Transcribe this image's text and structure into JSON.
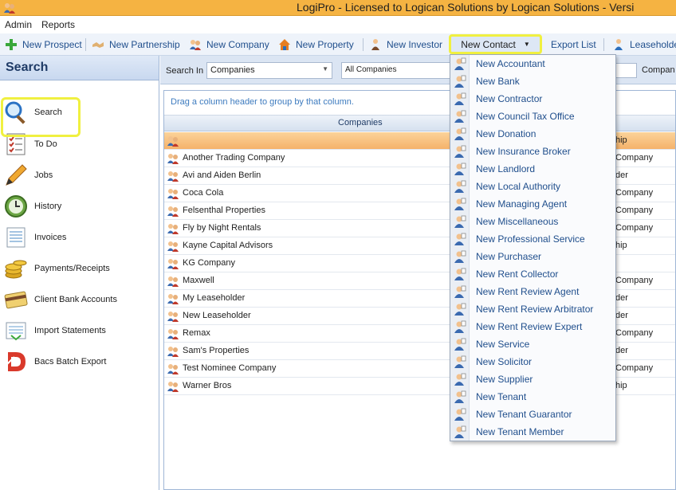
{
  "window": {
    "title": "LogiPro - Licensed to Logican Solutions by Logican Solutions - Versi"
  },
  "menu": {
    "admin": "Admin",
    "reports": "Reports"
  },
  "toolbar": {
    "new_prospect": "New Prospect",
    "new_partnership": "New Partnership",
    "new_company": "New Company",
    "new_property": "New Property",
    "new_investor": "New Investor",
    "new_contact": "New Contact",
    "export_list": "Export List",
    "leaseholder": "Leaseholde"
  },
  "sidebar": {
    "header": "Search",
    "items": [
      {
        "label": "Search",
        "icon": "magnifier-icon"
      },
      {
        "label": "To Do",
        "icon": "checklist-icon"
      },
      {
        "label": "Jobs",
        "icon": "pencil-icon"
      },
      {
        "label": "History",
        "icon": "clock-icon"
      },
      {
        "label": "Invoices",
        "icon": "invoice-icon"
      },
      {
        "label": "Payments/Receipts",
        "icon": "coins-icon"
      },
      {
        "label": "Client Bank Accounts",
        "icon": "card-icon"
      },
      {
        "label": "Import Statements",
        "icon": "import-icon"
      },
      {
        "label": "Bacs Batch Export",
        "icon": "bacs-icon"
      }
    ]
  },
  "search": {
    "label": "Search In",
    "search_in_value": "Companies",
    "filter_value": "All Companies",
    "right_label": "Compan"
  },
  "grid": {
    "group_hint": "Drag a column header to group by that column.",
    "column_header": "Companies",
    "rows": [
      {
        "name": "",
        "type": "hip",
        "selected": true
      },
      {
        "name": "Another Trading Company",
        "type": "Company"
      },
      {
        "name": "Avi and Aiden Berlin",
        "type": "der"
      },
      {
        "name": "Coca Cola",
        "type": "Company"
      },
      {
        "name": "Felsenthal Properties",
        "type": "Company"
      },
      {
        "name": "Fly by Night Rentals",
        "type": "Company"
      },
      {
        "name": "Kayne Capital Advisors",
        "type": "hip"
      },
      {
        "name": "KG Company",
        "type": ""
      },
      {
        "name": "Maxwell",
        "type": "Company"
      },
      {
        "name": "My Leaseholder",
        "type": "der"
      },
      {
        "name": "New Leaseholder",
        "type": "der"
      },
      {
        "name": "Remax",
        "type": "Company"
      },
      {
        "name": "Sam's Properties",
        "type": "der"
      },
      {
        "name": "Test Nominee Company",
        "type": "Company"
      },
      {
        "name": "Warner Bros",
        "type": "hip"
      }
    ]
  },
  "contact_menu": {
    "items": [
      "New Accountant",
      "New Bank",
      "New Contractor",
      "New Council Tax Office",
      "New Donation",
      "New Insurance Broker",
      "New Landlord",
      "New Local Authority",
      "New Managing Agent",
      "New Miscellaneous",
      "New Professional Service",
      "New Purchaser",
      "New Rent Collector",
      "New Rent Review Agent",
      "New Rent Review Arbitrator",
      "New Rent Review Expert",
      "New Service",
      "New Solicitor",
      "New Supplier",
      "New Tenant",
      "New Tenant Guarantor",
      "New Tenant Member"
    ]
  }
}
